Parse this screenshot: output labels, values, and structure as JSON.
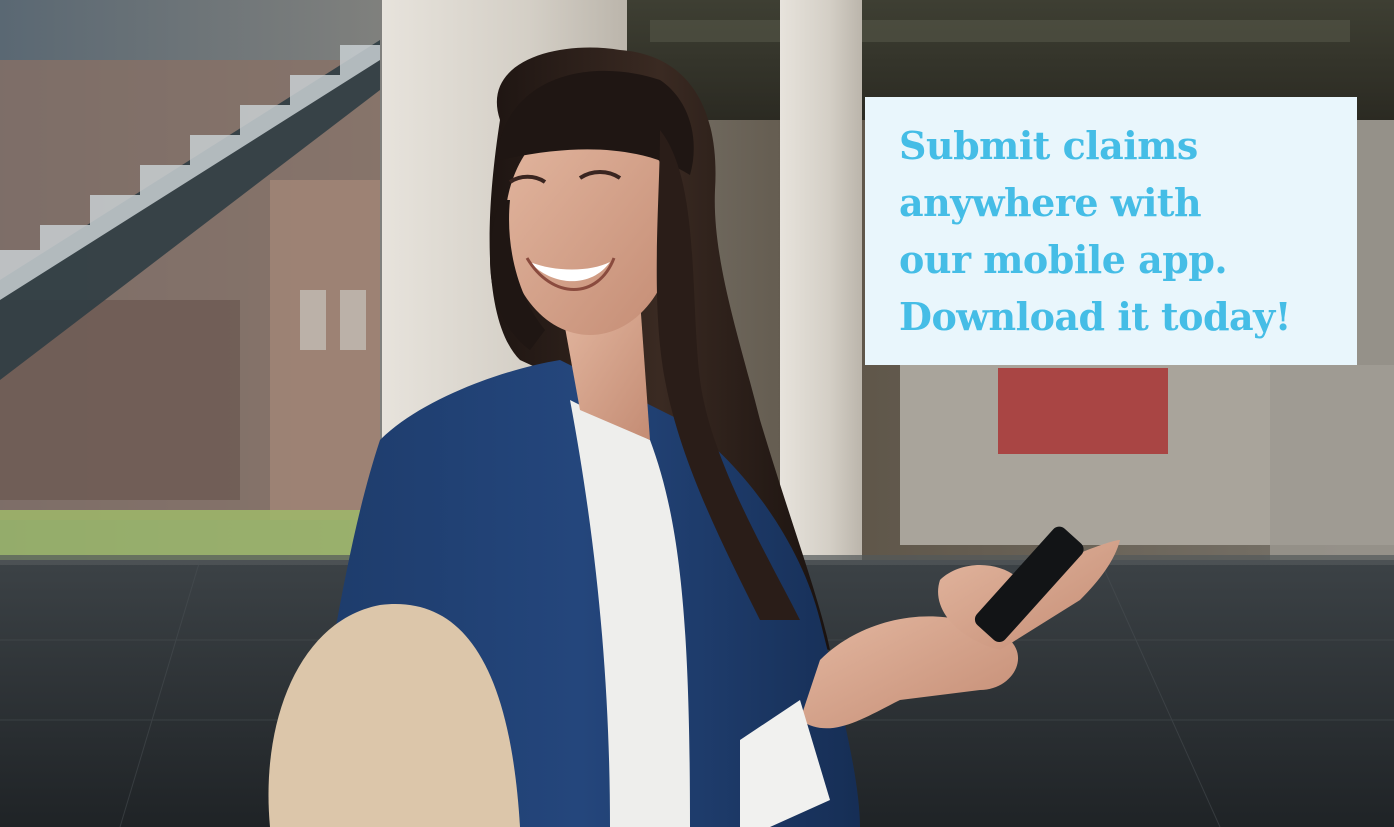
{
  "banner": {
    "headline_lines": [
      "Submit claims",
      "anywhere with",
      "our mobile app.",
      "Download it today!"
    ],
    "accent_color": "#45bde6",
    "panel_color": "#e9f6fc"
  },
  "photo": {
    "subject": "smiling-woman-holding-phone"
  }
}
